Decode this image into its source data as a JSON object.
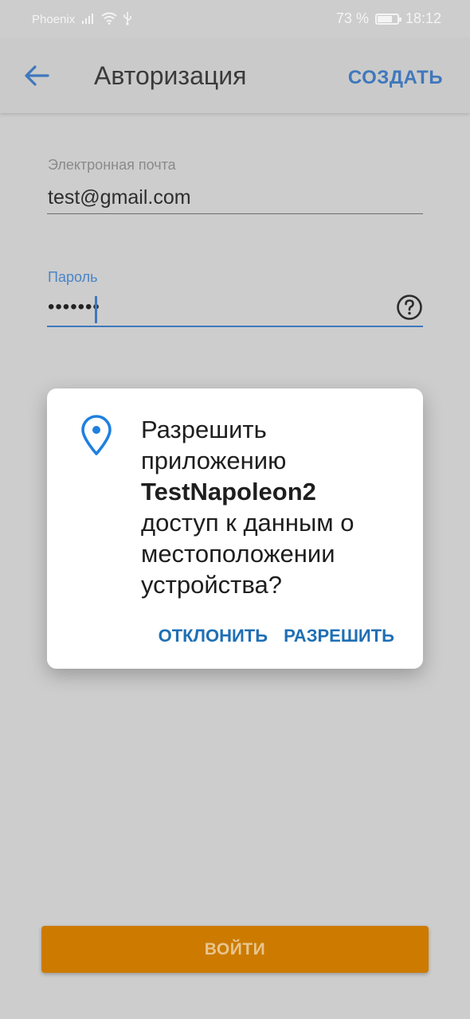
{
  "status_bar": {
    "carrier": "Phoenix",
    "battery_percent": "73 %",
    "battery_level": 0.73,
    "time": "18:12",
    "icons": [
      "signal-icon",
      "wifi-icon",
      "usb-icon",
      "battery-charging-icon"
    ]
  },
  "app_bar": {
    "back_icon": "arrow-left-icon",
    "title": "Авторизация",
    "create_label": "СОЗДАТЬ"
  },
  "form": {
    "email": {
      "label": "Электронная почта",
      "value": "test@gmail.com"
    },
    "password": {
      "label": "Пароль",
      "masked_value": "•••••••",
      "help_icon": "help-circle-icon"
    }
  },
  "dialog": {
    "icon": "location-pin-icon",
    "text_before": "Разрешить приложению",
    "app_name": "TestNapoleon2",
    "text_after": "доступ к данным о местоположении устройства?",
    "deny_label": "ОТКЛОНИТЬ",
    "allow_label": "РАЗРЕШИТЬ"
  },
  "login_button": {
    "label": "ВОЙТИ"
  },
  "colors": {
    "accent": "#3f78bd",
    "primary_button": "#cc7b00",
    "dialog_action": "#1f6fb4",
    "scrim_background": "#cdcdcd"
  }
}
